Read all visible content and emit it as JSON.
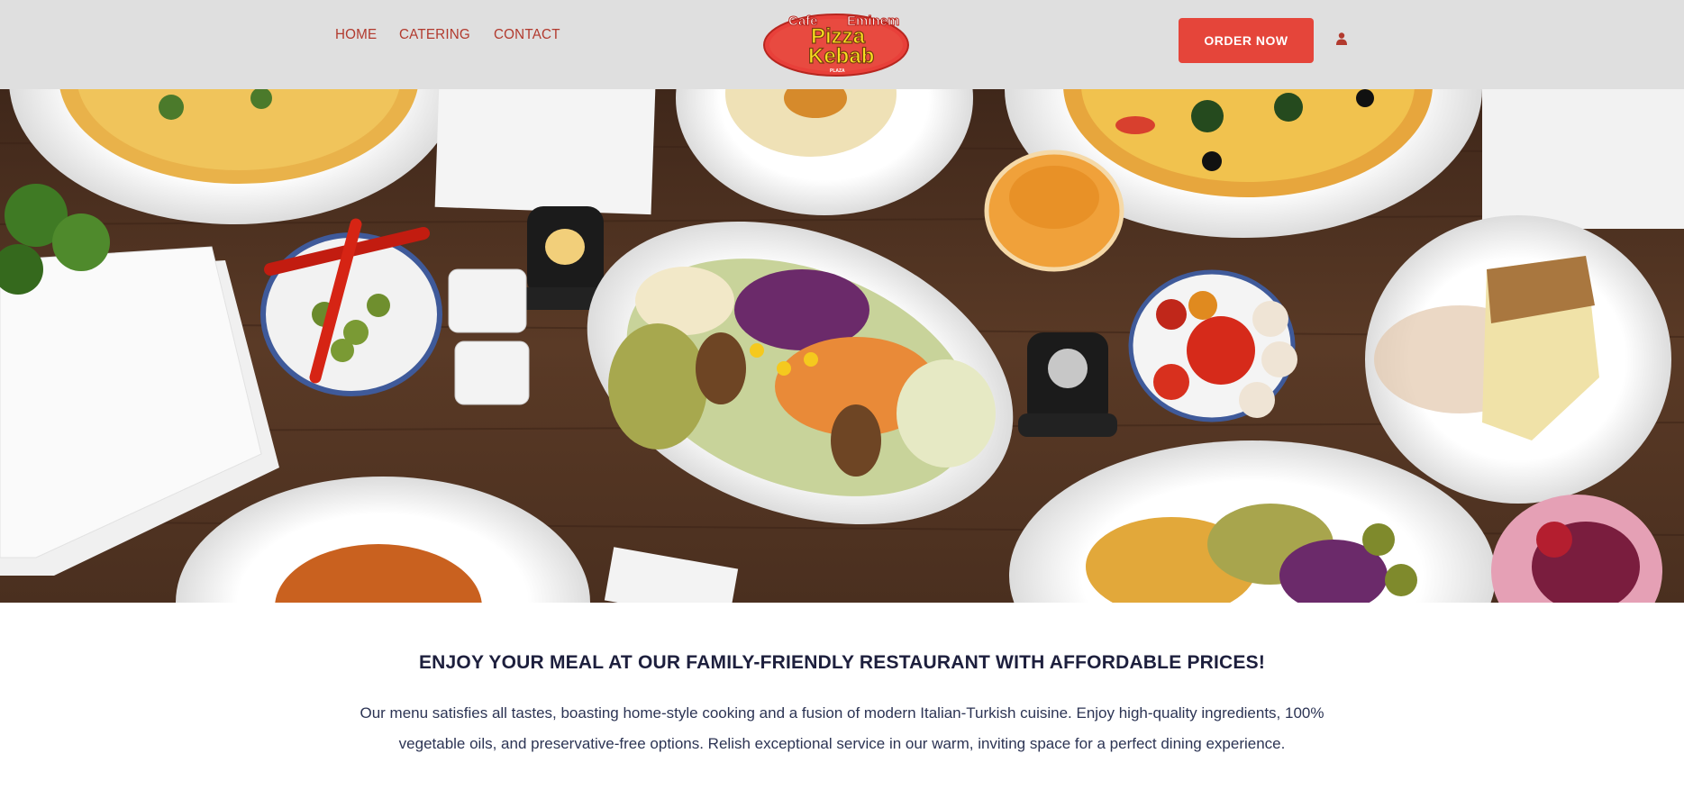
{
  "header": {
    "nav": [
      "HOME",
      "CATERING",
      "CONTACT"
    ],
    "logo": {
      "top_left": "Cafe",
      "top_right": "Eminem",
      "line1": "Pizza",
      "line2": "Kebab",
      "bottom": "PLAZA"
    },
    "order_button": "ORDER NOW",
    "account_icon": "user-icon"
  },
  "hero": {
    "image": "overhead table of Italian-Turkish dishes"
  },
  "intro": {
    "headline": "ENJOY YOUR MEAL AT OUR FAMILY-FRIENDLY RESTAURANT WITH AFFORDABLE PRICES!",
    "description": "Our menu satisfies all tastes, boasting home-style cooking and a fusion of modern Italian-Turkish cuisine. Enjoy high-quality ingredients, 100% vegetable oils, and preservative-free options. Relish exceptional service in our warm, inviting space for a perfect dining experience."
  },
  "colors": {
    "accent": "#e5453a",
    "nav": "#b23a2e",
    "header_bg": "#dfdfdf",
    "heading": "#1d1f3d"
  }
}
